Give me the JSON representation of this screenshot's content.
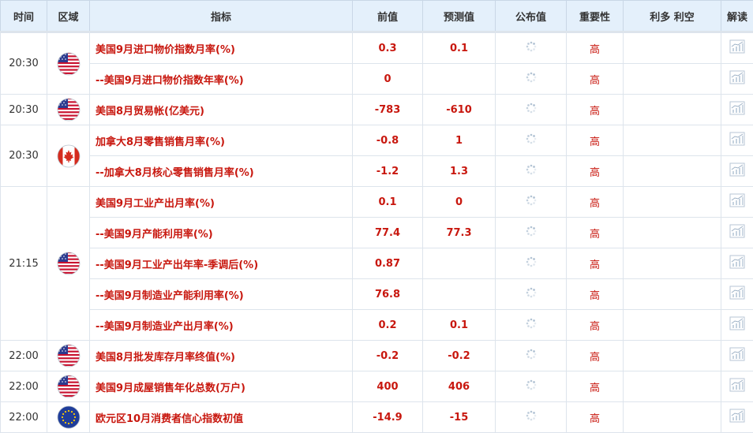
{
  "header": {
    "time": "时间",
    "region": "区域",
    "indicator": "指标",
    "previous": "前值",
    "forecast": "预测值",
    "actual": "公布值",
    "importance": "重要性",
    "bull_bear": "利多 利空",
    "interpret": "解读"
  },
  "groups": [
    {
      "time": "20:30",
      "flag": "us",
      "rows": [
        {
          "indicator": "美国9月进口物价指数月率(%)",
          "previous": "0.3",
          "forecast": "0.1",
          "importance": "高"
        },
        {
          "indicator": "--美国9月进口物价指数年率(%)",
          "previous": "0",
          "forecast": "",
          "importance": "高"
        }
      ]
    },
    {
      "time": "20:30",
      "flag": "us",
      "rows": [
        {
          "indicator": "美国8月贸易帐(亿美元)",
          "previous": "-783",
          "forecast": "-610",
          "importance": "高"
        }
      ]
    },
    {
      "time": "20:30",
      "flag": "ca",
      "rows": [
        {
          "indicator": "加拿大8月零售销售月率(%)",
          "previous": "-0.8",
          "forecast": "1",
          "importance": "高"
        },
        {
          "indicator": "--加拿大8月核心零售销售月率(%)",
          "previous": "-1.2",
          "forecast": "1.3",
          "importance": "高"
        }
      ]
    },
    {
      "time": "21:15",
      "flag": "us",
      "rows": [
        {
          "indicator": "美国9月工业产出月率(%)",
          "previous": "0.1",
          "forecast": "0",
          "importance": "高"
        },
        {
          "indicator": "--美国9月产能利用率(%)",
          "previous": "77.4",
          "forecast": "77.3",
          "importance": "高"
        },
        {
          "indicator": "--美国9月工业产出年率-季调后(%)",
          "previous": "0.87",
          "forecast": "",
          "importance": "高"
        },
        {
          "indicator": "--美国9月制造业产能利用率(%)",
          "previous": "76.8",
          "forecast": "",
          "importance": "高"
        },
        {
          "indicator": "--美国9月制造业产出月率(%)",
          "previous": "0.2",
          "forecast": "0.1",
          "importance": "高"
        }
      ]
    },
    {
      "time": "22:00",
      "flag": "us",
      "rows": [
        {
          "indicator": "美国8月批发库存月率终值(%)",
          "previous": "-0.2",
          "forecast": "-0.2",
          "importance": "高"
        }
      ]
    },
    {
      "time": "22:00",
      "flag": "us",
      "rows": [
        {
          "indicator": "美国9月成屋销售年化总数(万户)",
          "previous": "400",
          "forecast": "406",
          "importance": "高"
        }
      ]
    },
    {
      "time": "22:00",
      "flag": "eu",
      "rows": [
        {
          "indicator": "欧元区10月消费者信心指数初值",
          "previous": "-14.9",
          "forecast": "-15",
          "importance": "高"
        }
      ]
    }
  ],
  "colors": {
    "header_bg": "#e4f0fb",
    "value_red": "#c8170e",
    "border": "#dde4ec"
  },
  "icons": {
    "actual_pending": "loading-spinner-icon",
    "interpret": "chart-analysis-icon"
  }
}
